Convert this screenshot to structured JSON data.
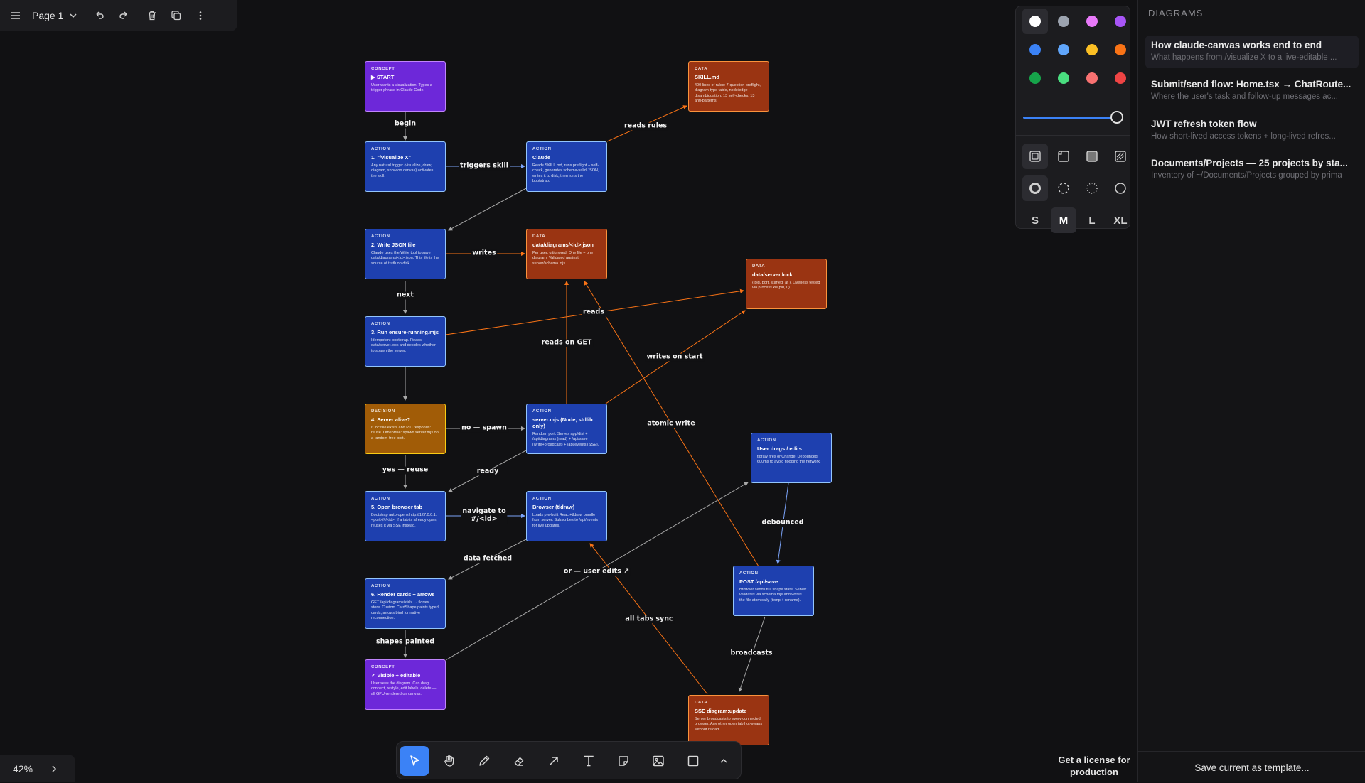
{
  "topbar": {
    "page_name": "Page 1"
  },
  "cards": [
    {
      "id": "start",
      "kind": "concept",
      "tag": "CONCEPT",
      "title": "▶ START",
      "body": "User wants a visualization. Types a trigger phrase in Claude Code."
    },
    {
      "id": "a1",
      "kind": "action",
      "tag": "ACTION",
      "title": "1. \"/visualize X\"",
      "body": "Any natural trigger (visualize, draw, diagram, show on canvas) activates the skill."
    },
    {
      "id": "claude",
      "kind": "action",
      "tag": "ACTION",
      "title": "Claude",
      "body": "Reads SKILL.md, runs preflight + self-check, generates schema-valid JSON, writes it to disk, then runs the bootstrap."
    },
    {
      "id": "skill",
      "kind": "data",
      "tag": "DATA",
      "title": "SKILL.md",
      "body": "400 lines of rules: 7-question preflight, diagram-type table, node/edge disambiguation, 13 self-checks, 13 anti-patterns."
    },
    {
      "id": "a2",
      "kind": "action",
      "tag": "ACTION",
      "title": "2. Write JSON file",
      "body": "Claude uses the Write tool to save data/diagrams/<id>.json. This file is the source of truth on disk."
    },
    {
      "id": "djson",
      "kind": "data",
      "tag": "DATA",
      "title": "data/diagrams/<id>.json",
      "body": "Per user, gitignored. One file = one diagram. Validated against server/schema.mjs."
    },
    {
      "id": "lock",
      "kind": "data",
      "tag": "DATA",
      "title": "data/server.lock",
      "body": "{ pid, port, started_at }. Liveness tested via process.kill(pid, 0)."
    },
    {
      "id": "a3",
      "kind": "action",
      "tag": "ACTION",
      "title": "3. Run ensure-running.mjs",
      "body": "Idempotent bootstrap. Reads data/server.lock and decides whether to spawn the server."
    },
    {
      "id": "dec4",
      "kind": "decision",
      "tag": "DECISION",
      "title": "4. Server alive?",
      "body": "If lockfile exists and PID responds: reuse. Otherwise: spawn server.mjs on a random-free port."
    },
    {
      "id": "server",
      "kind": "action",
      "tag": "ACTION",
      "title": "server.mjs (Node, stdlib only)",
      "body": "Random port. Serves app/dist + /api/diagrams (read) + /api/save (write+broadcast) + /api/events (SSE)."
    },
    {
      "id": "drags",
      "kind": "action",
      "tag": "ACTION",
      "title": "User drags / edits",
      "body": "tldraw fires onChange. Debounced 600ms to avoid flooding the network."
    },
    {
      "id": "a5",
      "kind": "action",
      "tag": "ACTION",
      "title": "5. Open browser tab",
      "body": "Bootstrap auto-opens http://127.0.0.1:<port>/#/<id>. If a tab is already open, reuses it via SSE instead."
    },
    {
      "id": "browser",
      "kind": "action",
      "tag": "ACTION",
      "title": "Browser (tldraw)",
      "body": "Loads pre-built React+tldraw bundle from server. Subscribes to /api/events for live updates."
    },
    {
      "id": "post",
      "kind": "action",
      "tag": "ACTION",
      "title": "POST /api/save",
      "body": "Browser sends full shape state. Server validates via schema.mjs and writes the file atomically (temp + rename)."
    },
    {
      "id": "a6",
      "kind": "action",
      "tag": "ACTION",
      "title": "6. Render cards + arrows",
      "body": "GET /api/diagrams/<id> → tldraw store. Custom CardShape paints typed cards, arrows bind for native reconnection."
    },
    {
      "id": "visible",
      "kind": "concept",
      "tag": "CONCEPT",
      "title": "✓ Visible + editable",
      "body": "User sees the diagram. Can drag, connect, restyle, edit labels, delete — all GPU-rendered on canvas."
    },
    {
      "id": "sse",
      "kind": "data",
      "tag": "DATA",
      "title": "SSE diagram:update",
      "body": "Server broadcasts to every connected browser. Any other open tab hot-swaps without reload."
    }
  ],
  "edge_labels": [
    {
      "id": "begin",
      "text": "begin"
    },
    {
      "id": "triggers",
      "text": "triggers skill"
    },
    {
      "id": "reads_rules",
      "text": "reads rules"
    },
    {
      "id": "writes",
      "text": "writes"
    },
    {
      "id": "next",
      "text": "next"
    },
    {
      "id": "reads",
      "text": "reads"
    },
    {
      "id": "reads_get",
      "text": "reads on GET"
    },
    {
      "id": "writes_start",
      "text": "writes on start"
    },
    {
      "id": "no_spawn",
      "text": "no — spawn"
    },
    {
      "id": "atomic",
      "text": "atomic write"
    },
    {
      "id": "yes_reuse",
      "text": "yes — reuse"
    },
    {
      "id": "ready",
      "text": "ready"
    },
    {
      "id": "navigate",
      "text": "navigate to\n#/<id>"
    },
    {
      "id": "debounced",
      "text": "debounced"
    },
    {
      "id": "data_fetched",
      "text": "data fetched"
    },
    {
      "id": "user_edits",
      "text": "or — user edits ↗"
    },
    {
      "id": "tabs_sync",
      "text": "all tabs sync"
    },
    {
      "id": "shapes",
      "text": "shapes painted"
    },
    {
      "id": "broadcasts",
      "text": "broadcasts"
    }
  ],
  "style_panel": {
    "colors": [
      "#ffffff",
      "#9ca3af",
      "#e879f9",
      "#a855f7",
      "#3b82f6",
      "#60a5fa",
      "#fbbf24",
      "#f97316",
      "#16a34a",
      "#4ade80",
      "#f87171",
      "#ef4444"
    ],
    "selected_color": "#ffffff",
    "opacity_percent": 100,
    "sizes": [
      "S",
      "M",
      "L",
      "XL"
    ],
    "selected_size": "M"
  },
  "sidebar": {
    "heading": "DIAGRAMS",
    "items": [
      {
        "title": "How claude-canvas works end to end",
        "subtitle": "What happens from /visualize X to a live-editable ..."
      },
      {
        "title": "Submit/send flow: Home.tsx → ChatRoute...",
        "subtitle": "Where the user's task and follow-up messages ac..."
      },
      {
        "title": "JWT refresh token flow",
        "subtitle": "How short-lived access tokens + long-lived refres..."
      },
      {
        "title": "Documents/Projects — 25 projects by sta...",
        "subtitle": "Inventory of ~/Documents/Projects grouped by prima"
      }
    ],
    "save_template": "Save current as template..."
  },
  "zoom": {
    "level": "42%"
  },
  "license": "Get a license for production"
}
